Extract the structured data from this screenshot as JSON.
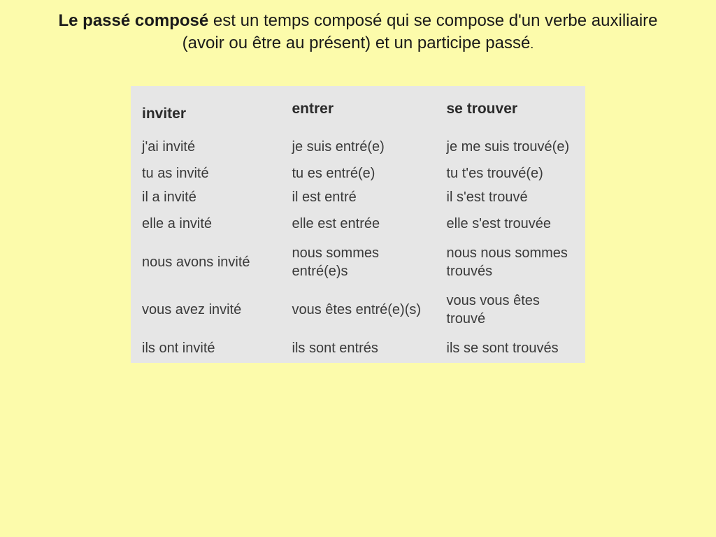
{
  "heading": {
    "bold": "Le passé composé",
    "rest1": " est un temps composé qui se compose d'un verbe auxiliaire",
    "rest2": "(avoir ou être au présent) et un participe passé",
    "period": "."
  },
  "table": {
    "headers": {
      "col1": "inviter",
      "col2": "entrer",
      "col3": "se trouver"
    },
    "rows": [
      {
        "c1": "j'ai invité",
        "c2": "je suis entré(e)",
        "c3": "je me suis trouvé(e)"
      },
      {
        "c1": "tu as invité",
        "c2": "tu es entré(e)",
        "c3": "tu t'es trouvé(e)"
      },
      {
        "c1": "il a invité",
        "c2": "il est entré",
        "c3": "il s'est trouvé"
      },
      {
        "c1": "elle a invité",
        "c2": "elle est entrée",
        "c3": "elle s'est trouvée"
      },
      {
        "c1": "nous avons invité",
        "c2": "nous sommes entré(e)s",
        "c3": "nous nous sommes trouvés"
      },
      {
        "c1": "vous avez invité",
        "c2": "vous êtes entré(e)(s)",
        "c3": "vous vous êtes trouvé"
      },
      {
        "c1": "ils ont invité",
        "c2": "ils sont entrés",
        "c3": "ils se sont trouvés"
      }
    ]
  }
}
